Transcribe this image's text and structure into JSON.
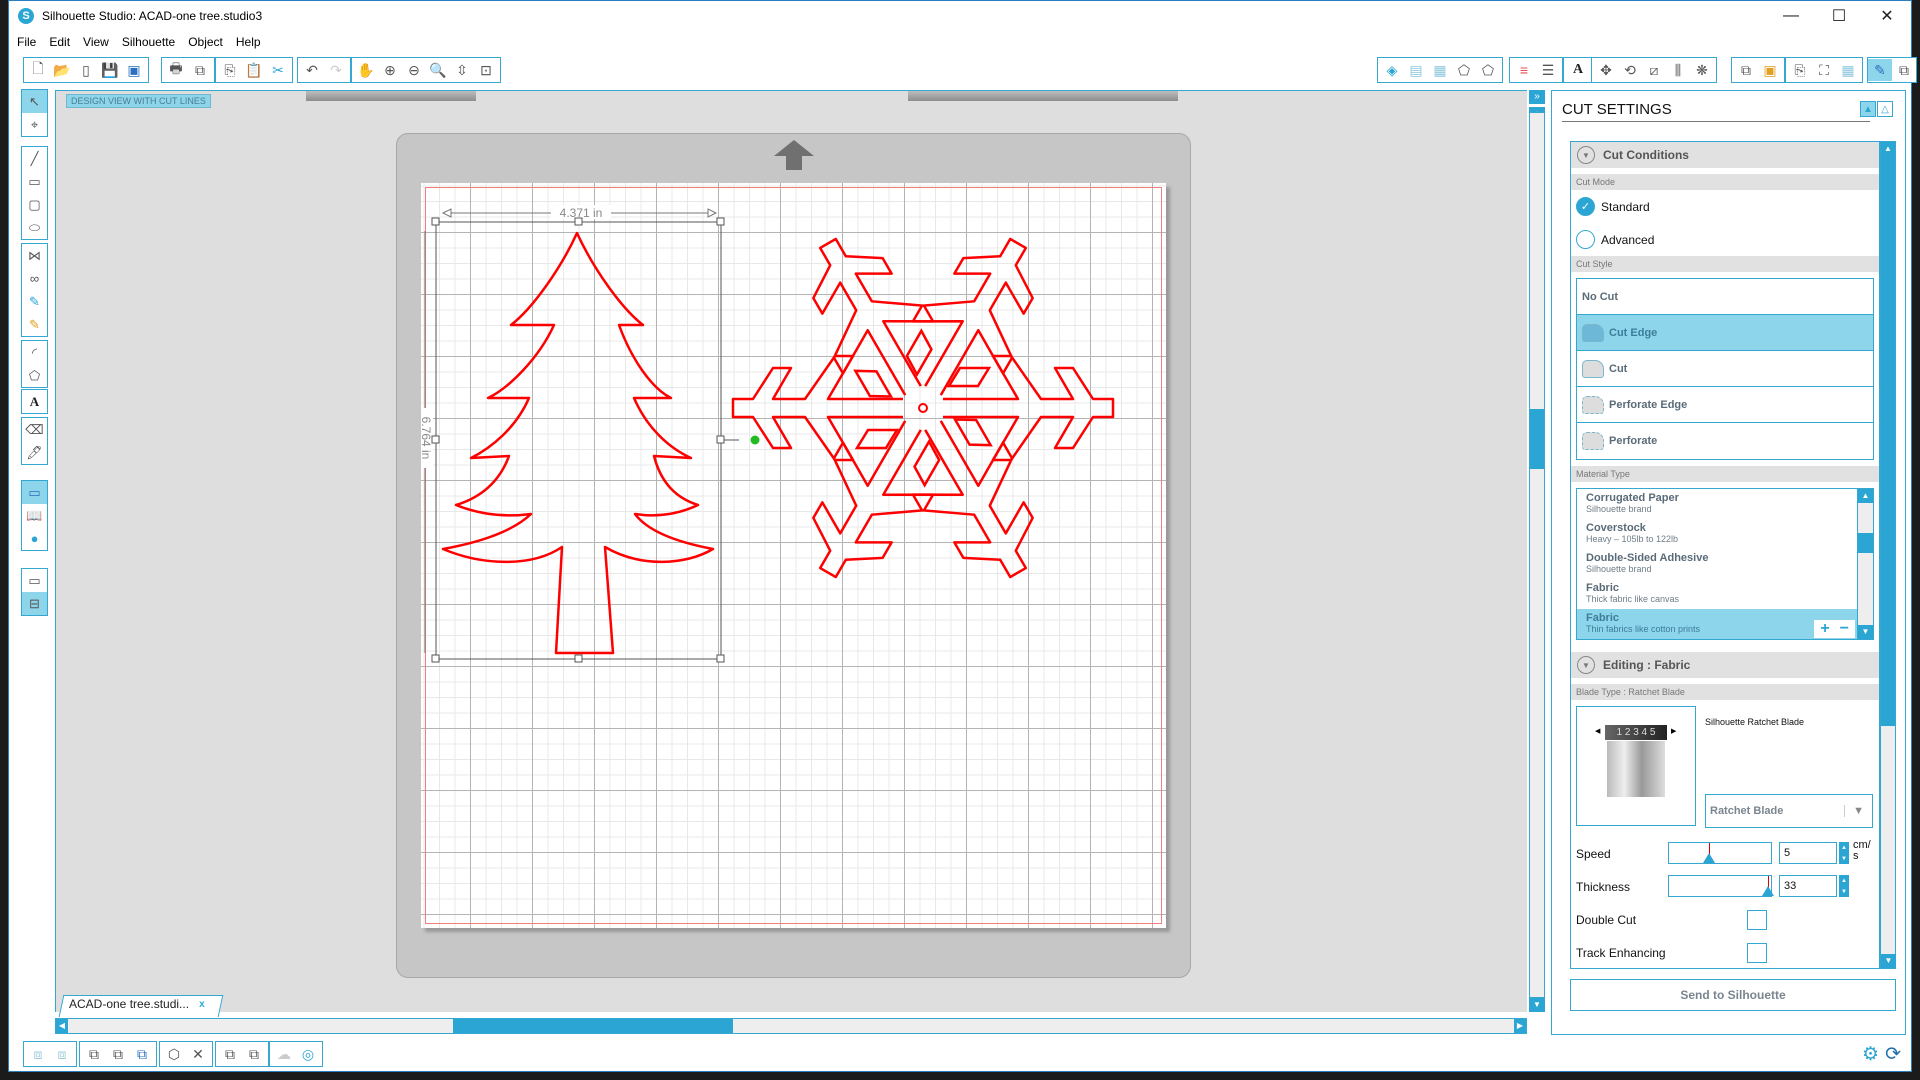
{
  "window": {
    "title": "Silhouette Studio: ACAD-one tree.studio3",
    "controls": {
      "minimize": "—",
      "maximize": "☐",
      "close": "✕"
    }
  },
  "menu": [
    "File",
    "Edit",
    "View",
    "Silhouette",
    "Object",
    "Help"
  ],
  "toolbar_top": {
    "file_group": [
      "new-document",
      "open-folder",
      "template",
      "save",
      "save-to-library"
    ],
    "print_group": [
      "print",
      "send-to-cutter"
    ],
    "clipboard_group": [
      "copy",
      "paste",
      "cut-scissors"
    ],
    "history_group": [
      "undo",
      "redo"
    ],
    "view_group": [
      "pan-hand",
      "zoom-in",
      "zoom-out",
      "zoom-selection",
      "fit-to-page",
      "zoom-to-page"
    ],
    "right_groups": [
      [
        "fill-color",
        "fill-gradient",
        "fill-pattern",
        "line-color",
        "line-style"
      ],
      [
        "line-colors",
        "line-styles"
      ],
      [
        "text-style"
      ],
      [
        "transform",
        "rotate",
        "scale",
        "align",
        "replicate"
      ],
      [
        "modify",
        "offset"
      ],
      [
        "page-setup",
        "registration",
        "grid"
      ],
      [
        "cut-settings",
        "send"
      ]
    ]
  },
  "left_tools": {
    "groups": [
      [
        "select",
        "point-edit"
      ],
      [
        "line",
        "rectangle",
        "rounded-rectangle",
        "ellipse"
      ],
      [
        "polygon",
        "curve",
        "freehand",
        "smooth-freehand"
      ],
      [
        "arc",
        "regular-polygon"
      ],
      [
        "text"
      ],
      [
        "eraser",
        "knife"
      ],
      [
        "design-view",
        "library",
        "silhouette-store"
      ],
      [
        "single-view",
        "split-view"
      ]
    ]
  },
  "canvas": {
    "view_label": "DESIGN VIEW WITH CUT LINES",
    "width_dimension": "4.371 in",
    "height_dimension": "6.764 in",
    "cut_line_color": "#ff0000",
    "selection_point_color": "#22bb22"
  },
  "document_tab": {
    "label": "ACAD-one tree.studi...",
    "close": "x"
  },
  "scrollbars": {
    "vertical_position_fraction": 0.36,
    "horizontal_position_fraction": 0.33
  },
  "bottom_tools": [
    "group",
    "ungroup",
    "compound-path",
    "release-compound",
    "make-compound",
    "weld",
    "delete",
    "bring-forward",
    "send-backward",
    "shape",
    "offset-rings"
  ],
  "cut_settings": {
    "title": "CUT SETTINGS",
    "cut_conditions": {
      "header": "Cut Conditions",
      "cut_mode_label": "Cut Mode",
      "modes": [
        {
          "label": "Standard",
          "checked": true
        },
        {
          "label": "Advanced",
          "checked": false
        }
      ],
      "cut_style_label": "Cut Style",
      "cut_styles": [
        {
          "label": "No Cut",
          "selected": false,
          "icon": ""
        },
        {
          "label": "Cut Edge",
          "selected": true,
          "icon": "cut-edge-icon"
        },
        {
          "label": "Cut",
          "selected": false,
          "icon": "cut-icon"
        },
        {
          "label": "Perforate Edge",
          "selected": false,
          "icon": "perforate-edge-icon"
        },
        {
          "label": "Perforate",
          "selected": false,
          "icon": "perforate-icon"
        }
      ],
      "material_type_label": "Material Type",
      "materials": [
        {
          "name": "Corrugated Paper",
          "desc": "Silhouette brand",
          "selected": false
        },
        {
          "name": "Coverstock",
          "desc": "Heavy – 105lb to 122lb",
          "selected": false
        },
        {
          "name": "Double-Sided Adhesive",
          "desc": "Silhouette brand",
          "selected": false
        },
        {
          "name": "Fabric",
          "desc": "Thick fabric like canvas",
          "selected": false
        },
        {
          "name": "Fabric",
          "desc": "Thin fabrics like cotton prints",
          "selected": true
        }
      ],
      "add": "+",
      "remove": "−"
    },
    "editing": {
      "header": "Editing : Fabric",
      "blade_type_label": "Blade Type : Ratchet Blade",
      "blade_name": "Silhouette Ratchet Blade",
      "blade_numbers": "1 2 3 4 5",
      "blade_select": "Ratchet Blade",
      "speed": {
        "label": "Speed",
        "value": "5",
        "unit": "cm/ s",
        "fraction": 0.4
      },
      "thickness": {
        "label": "Thickness",
        "value": "33",
        "fraction": 1.0
      },
      "double_cut": {
        "label": "Double Cut",
        "checked": false
      },
      "track_enhancing": {
        "label": "Track Enhancing",
        "checked": false
      }
    },
    "send_button": "Send to Silhouette"
  }
}
